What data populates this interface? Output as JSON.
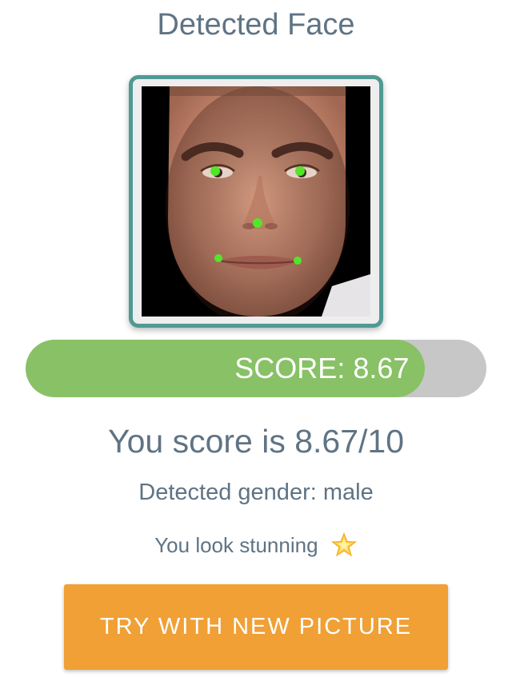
{
  "header": {
    "title": "Detected Face"
  },
  "face": {
    "landmark_color": "#52e52a",
    "frame_color": "#4f9a93"
  },
  "score_bar": {
    "label": "SCORE: 8.67",
    "value": 8.67,
    "max": 10,
    "fill_color": "#88c166",
    "track_color": "#c7c7c7"
  },
  "result": {
    "score_text": "You score is 8.67/10",
    "gender_text": "Detected gender: male",
    "compliment_text": "You look stunning",
    "compliment_icon": "glowing-star-icon"
  },
  "action": {
    "button_label": "TRY WITH NEW PICTURE",
    "button_color": "#f0a035"
  }
}
